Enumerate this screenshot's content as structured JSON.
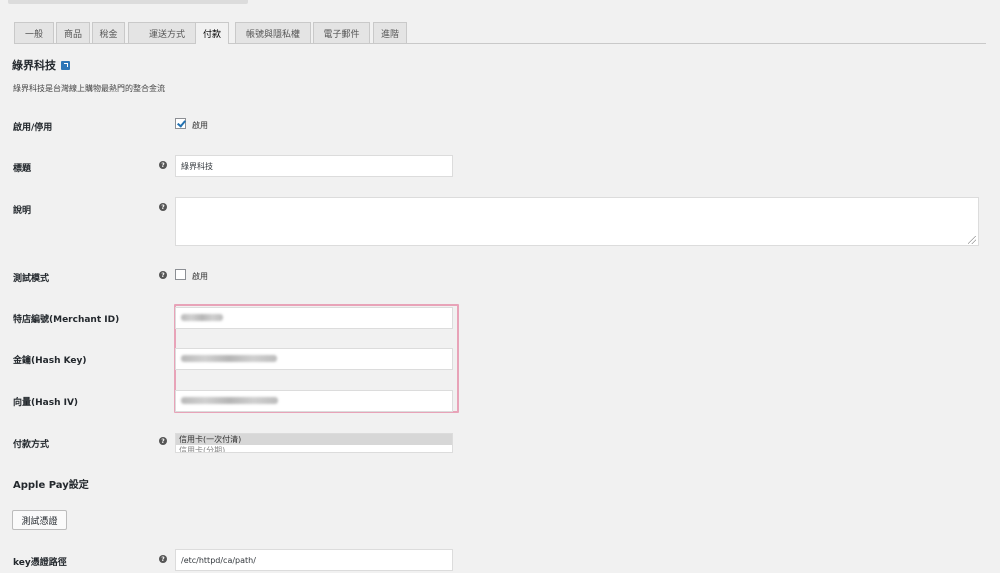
{
  "tabs": [
    {
      "label": "一般",
      "active": false
    },
    {
      "label": "商品",
      "active": false
    },
    {
      "label": "稅金",
      "active": false
    },
    {
      "label": "運送方式",
      "active": false
    },
    {
      "label": "付款",
      "active": true
    },
    {
      "label": "帳號與隱私權",
      "active": false
    },
    {
      "label": "電子郵件",
      "active": false
    },
    {
      "label": "進階",
      "active": false
    }
  ],
  "section": {
    "title": "綠界科技",
    "description": "綠界科技是台灣線上購物最熱門的整合金流"
  },
  "fields": {
    "enable": {
      "label": "啟用/停用",
      "checkbox_label": "啟用",
      "checked": true
    },
    "title": {
      "label": "標題",
      "value": "綠界科技"
    },
    "description": {
      "label": "說明",
      "value": ""
    },
    "test_mode": {
      "label": "測試模式",
      "checkbox_label": "啟用",
      "checked": false
    },
    "merchant_id": {
      "label": "特店編號(Merchant ID)"
    },
    "hash_key": {
      "label": "金鑰(Hash Key)"
    },
    "hash_iv": {
      "label": "向量(Hash IV)"
    },
    "payment_methods": {
      "label": "付款方式",
      "options": [
        "信用卡(一次付清)",
        "信用卡(分期)"
      ]
    },
    "key_cert_path": {
      "label": "key憑證路徑",
      "value": "/etc/httpd/ca/path/"
    }
  },
  "apple_pay": {
    "heading": "Apple Pay設定",
    "test_button_label": "測試憑證"
  },
  "help_glyph": "?",
  "colors": {
    "highlight_border": "#e8a3b8",
    "checkbox_check": "#2271b1",
    "link_icon": "#2e76b7"
  }
}
